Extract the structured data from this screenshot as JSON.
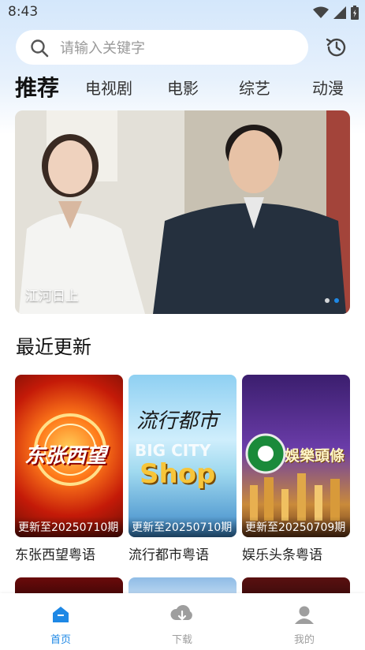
{
  "status_bar": {
    "time": "8:43"
  },
  "search": {
    "placeholder": "请输入关键字"
  },
  "tabs": [
    {
      "label": "推荐",
      "active": true
    },
    {
      "label": "电视剧",
      "active": false
    },
    {
      "label": "电影",
      "active": false
    },
    {
      "label": "综艺",
      "active": false
    },
    {
      "label": "动漫",
      "active": false
    }
  ],
  "banner": {
    "caption": "江河日上",
    "dot_count": 2,
    "active_dot": 2
  },
  "section": {
    "title": "最近更新"
  },
  "cards": [
    {
      "badge": "更新至20250710期",
      "title": "东张西望粤语",
      "logo_text": "东张西望"
    },
    {
      "badge": "更新至20250710期",
      "title": "流行都市粤语",
      "logo_text": "流行都市",
      "logo_sub": "BIG CITY",
      "logo_sub2": "Shop"
    },
    {
      "badge": "更新至20250709期",
      "title": "娱乐头条粤语",
      "logo_text": "娛樂頭條"
    }
  ],
  "bottom_nav": [
    {
      "label": "首页",
      "icon": "home-icon",
      "active": true
    },
    {
      "label": "下载",
      "icon": "download-icon",
      "active": false
    },
    {
      "label": "我的",
      "icon": "profile-icon",
      "active": false
    }
  ],
  "colors": {
    "accent": "#1e88e5",
    "inactive": "#9e9e9e"
  }
}
